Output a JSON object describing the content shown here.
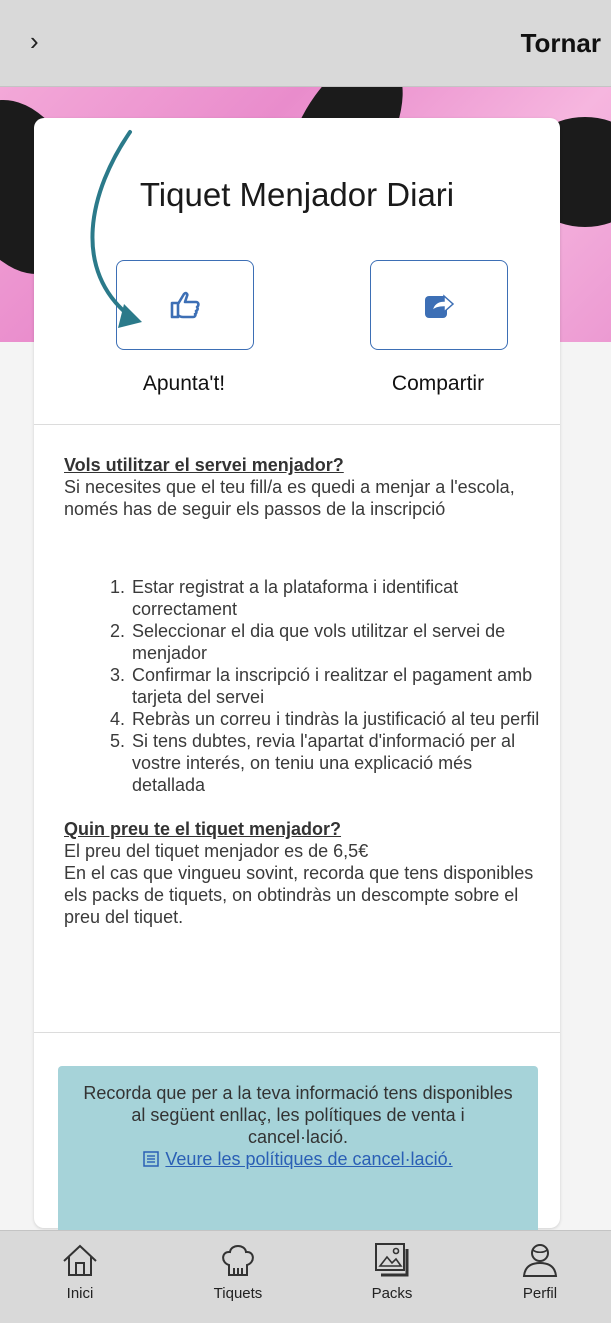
{
  "header": {
    "menu_icon": "chevron-right-icon",
    "back_label": "Tornar"
  },
  "card": {
    "title": "Tiquet Menjador Diari",
    "actions": [
      {
        "label": "Apunta't!",
        "icon": "thumbs-up-icon"
      },
      {
        "label": "Compartir",
        "icon": "share-icon"
      }
    ]
  },
  "info": {
    "q1": "Vols utilitzar el servei menjador?",
    "p1": "Si necesites que el teu fill/a es quedi a menjar a l'escola, només has de seguir els passos de la inscripció",
    "steps": [
      "Estar registrat a la plataforma i identificat correctament",
      "Seleccionar el dia que vols utilitzar el servei de menjador",
      "Confirmar la inscripció i realitzar el pagament amb tarjeta del servei",
      "Rebràs un correu i tindràs la justificació al teu perfil",
      "Si tens dubtes, revia l'apartat d'informació per al vostre interés, on teniu una explicació més detallada"
    ],
    "q2": "Quin preu te el tiquet menjador?",
    "p2a": "El preu del tiquet menjador es de 6,5€",
    "p2b": "En el cas que vingueu sovint, recorda que tens disponibles els packs de tiquets, on obtindràs un descompte sobre el preu del tiquet."
  },
  "notice": {
    "text": "Recorda que per a la teva informació tens disponibles al següent enllaç, les polítiques de venta i cancel·lació.",
    "link_label": "Veure les polítiques de cancel·lació.",
    "link_icon": "document-icon",
    "background": "#a6d3d9"
  },
  "nav": [
    {
      "label": "Inici",
      "icon": "home-icon"
    },
    {
      "label": "Tiquets",
      "icon": "chef-hat-icon"
    },
    {
      "label": "Packs",
      "icon": "image-gallery-icon"
    },
    {
      "label": "Perfil",
      "icon": "user-icon"
    }
  ],
  "colors": {
    "accent": "#3d6fb5",
    "arrow": "#2b7a8a",
    "bars": "#d9d9d9"
  }
}
